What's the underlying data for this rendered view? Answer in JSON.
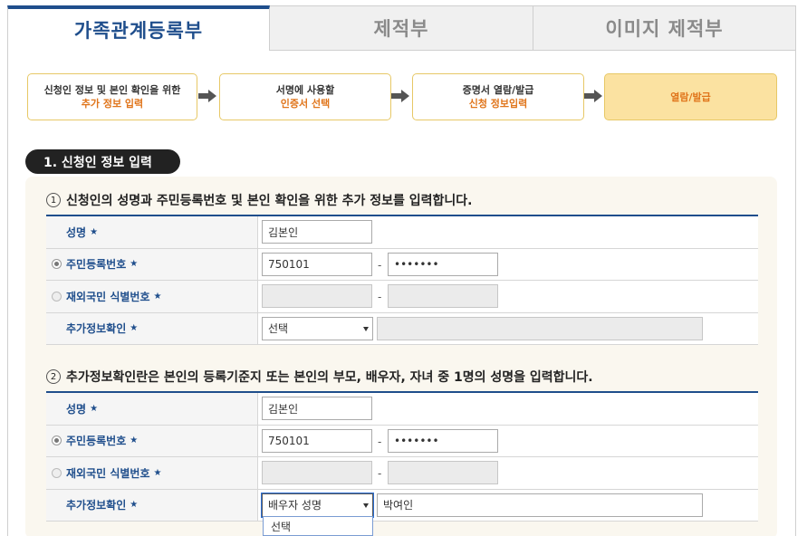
{
  "tabs": [
    {
      "label": "가족관계등록부"
    },
    {
      "label": "제적부"
    },
    {
      "label": "이미지 제적부"
    }
  ],
  "steps": [
    {
      "line1": "신청인 정보 및 본인 확인을 위한",
      "line2": "추가 정보 입력"
    },
    {
      "line1": "서명에 사용할",
      "line2": "인증서 선택"
    },
    {
      "line1": "증명서 열람/발급",
      "line2": "신청 정보입력"
    },
    {
      "line1": "열람/발급",
      "line2": ""
    }
  ],
  "section1": {
    "title": "1. 신청인 정보 입력"
  },
  "form1": {
    "number": "1",
    "note": "신청인의 성명과 주민등록번호 및 본인 확인을 위한 추가 정보를 입력합니다.",
    "labels": {
      "name": "성명",
      "rrn": "주민등록번호",
      "foreign": "재외국민 식별번호",
      "extra": "추가정보확인"
    },
    "required_mark": "★",
    "name_value": "김본인",
    "rrn_front": "750101",
    "rrn_back": "•••••••",
    "extra_select": "선택",
    "extra_input": ""
  },
  "form2": {
    "number": "2",
    "note": "추가정보확인란은 본인의 등록기준지 또는 본인의 부모, 배우자, 자녀 중 1명의 성명을 입력합니다.",
    "labels": {
      "name": "성명",
      "rrn": "주민등록번호",
      "foreign": "재외국민 식별번호",
      "extra": "추가정보확인"
    },
    "required_mark": "★",
    "name_value": "김본인",
    "rrn_front": "750101",
    "rrn_back": "•••••••",
    "extra_select": "배우자 성명",
    "extra_input": "박여인",
    "dropdown_option": "선택"
  },
  "colors": {
    "accent": "#1f4e8c",
    "step_border": "#e7c866",
    "step_current_bg": "#fbe2a1",
    "step_sub_text": "#e0751b"
  }
}
